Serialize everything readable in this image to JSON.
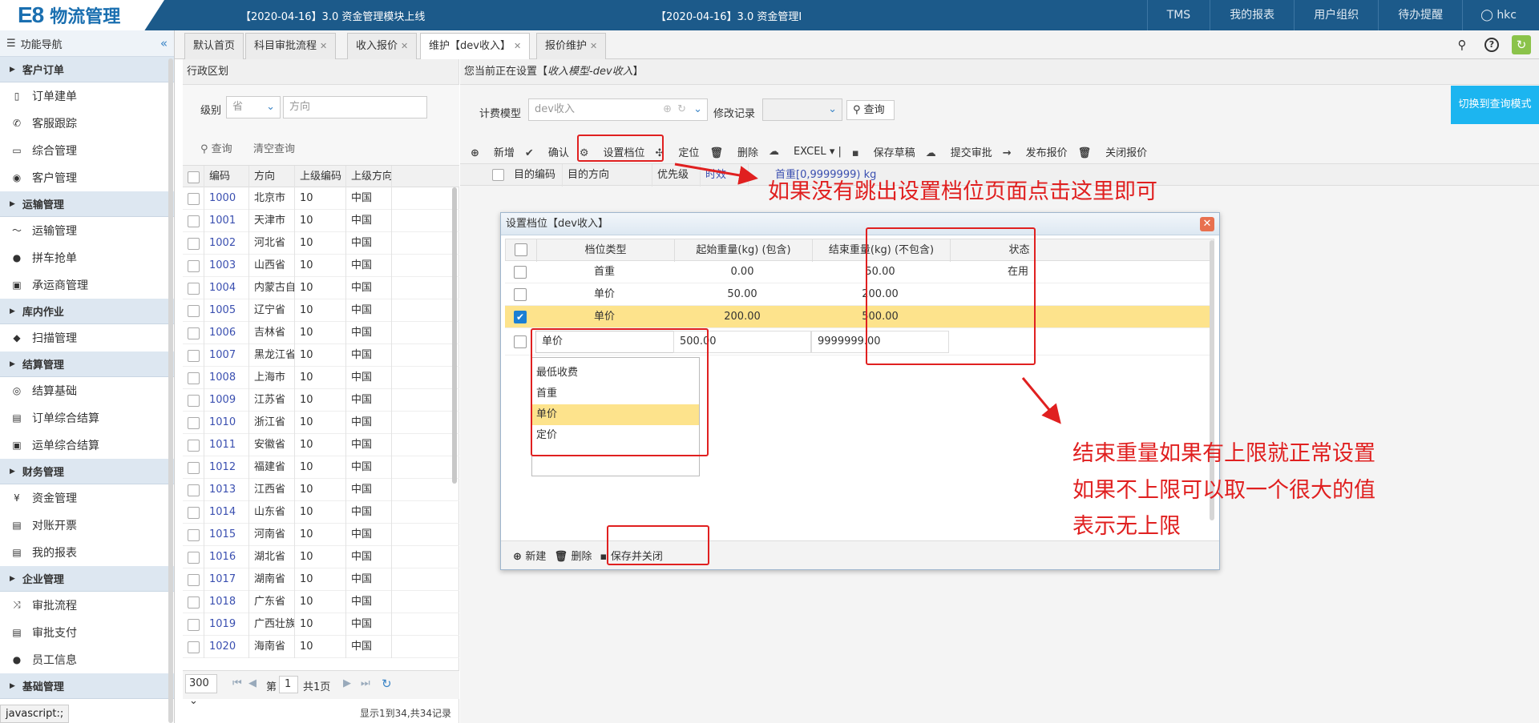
{
  "topbar": {
    "logo_mark": "E8",
    "logo_text": "物流管理",
    "notices": [
      "【2020-04-16】3.0 资金管理模块上线",
      "【2020-04-16】3.0 资金管理I"
    ],
    "nav": [
      "TMS",
      "我的报表",
      "用户组织",
      "待办提醒",
      "hkc"
    ]
  },
  "sidebar": {
    "title": "功能导航",
    "groups": [
      {
        "label": "客户订单",
        "items": [
          "订单建单",
          "客服跟踪",
          "综合管理",
          "客户管理"
        ]
      },
      {
        "label": "运输管理",
        "items": [
          "运输管理",
          "拼车抢单",
          "承运商管理"
        ]
      },
      {
        "label": "库内作业",
        "items": [
          "扫描管理"
        ]
      },
      {
        "label": "结算管理",
        "items": [
          "结算基础",
          "订单综合结算",
          "运单综合结算"
        ]
      },
      {
        "label": "财务管理",
        "items": [
          "资金管理",
          "对账开票",
          "我的报表"
        ]
      },
      {
        "label": "企业管理",
        "items": [
          "审批流程",
          "审批支付",
          "员工信息"
        ]
      },
      {
        "label": "基础管理",
        "items": []
      }
    ],
    "status": "javascript:;"
  },
  "tabs": [
    {
      "label": "默认首页",
      "closable": false
    },
    {
      "label": "科目审批流程",
      "closable": true
    },
    {
      "label": "收入报价",
      "closable": true
    },
    {
      "label": "维护【dev收入】",
      "closable": true,
      "active": true
    },
    {
      "label": "报价维护",
      "closable": true
    }
  ],
  "left_panel": {
    "title": "行政区划",
    "level_label": "级别",
    "level_value": "省",
    "direction_placeholder": "方向",
    "search_label": "查询",
    "clear_label": "清空查询",
    "columns": [
      "编码",
      "方向",
      "上级编码",
      "上级方向"
    ],
    "rows": [
      [
        "1000",
        "北京市",
        "10",
        "中国"
      ],
      [
        "1001",
        "天津市",
        "10",
        "中国"
      ],
      [
        "1002",
        "河北省",
        "10",
        "中国"
      ],
      [
        "1003",
        "山西省",
        "10",
        "中国"
      ],
      [
        "1004",
        "内蒙古自治区",
        "10",
        "中国"
      ],
      [
        "1005",
        "辽宁省",
        "10",
        "中国"
      ],
      [
        "1006",
        "吉林省",
        "10",
        "中国"
      ],
      [
        "1007",
        "黑龙江省",
        "10",
        "中国"
      ],
      [
        "1008",
        "上海市",
        "10",
        "中国"
      ],
      [
        "1009",
        "江苏省",
        "10",
        "中国"
      ],
      [
        "1010",
        "浙江省",
        "10",
        "中国"
      ],
      [
        "1011",
        "安徽省",
        "10",
        "中国"
      ],
      [
        "1012",
        "福建省",
        "10",
        "中国"
      ],
      [
        "1013",
        "江西省",
        "10",
        "中国"
      ],
      [
        "1014",
        "山东省",
        "10",
        "中国"
      ],
      [
        "1015",
        "河南省",
        "10",
        "中国"
      ],
      [
        "1016",
        "湖北省",
        "10",
        "中国"
      ],
      [
        "1017",
        "湖南省",
        "10",
        "中国"
      ],
      [
        "1018",
        "广东省",
        "10",
        "中国"
      ],
      [
        "1019",
        "广西壮族自治区",
        "10",
        "中国"
      ],
      [
        "1020",
        "海南省",
        "10",
        "中国"
      ]
    ],
    "pager": {
      "page_size": "300",
      "page_prefix": "第",
      "page": "1",
      "page_total": "共1页",
      "summary": "显示1到34,共34记录"
    }
  },
  "right_panel": {
    "title_prefix": "您当前正在设置【",
    "title_model": "收入模型-dev收入",
    "title_suffix": "】",
    "model_label": "计费模型",
    "model_value": "dev收入",
    "history_label": "修改记录",
    "search_label": "查询",
    "switch_label": "切换到查询模式",
    "actions": [
      "新增",
      "确认",
      "设置档位",
      "定位",
      "删除",
      "EXCEL",
      "保存草稿",
      "提交审批",
      "发布报价",
      "关闭报价"
    ],
    "columns": [
      "目的编码",
      "目的方向",
      "优先级",
      "时效",
      "首重[0,9999999) kg"
    ]
  },
  "dialog": {
    "title": "设置档位【dev收入】",
    "columns": [
      "档位类型",
      "起始重量(kg) (包含)",
      "结束重量(kg) (不包含)",
      "状态"
    ],
    "rows": [
      {
        "type": "首重",
        "start": "0.00",
        "end": "50.00",
        "status": "在用",
        "checked": false
      },
      {
        "type": "单价",
        "start": "50.00",
        "end": "200.00",
        "status": "",
        "checked": false
      },
      {
        "type": "单价",
        "start": "200.00",
        "end": "500.00",
        "status": "",
        "checked": true
      }
    ],
    "edit_row": {
      "type": "单价",
      "start": "500.00",
      "end": "9999999.00"
    },
    "dropdown_options": [
      "最低收费",
      "首重",
      "单价",
      "定价"
    ],
    "dropdown_selected": "单价",
    "footer": [
      "新建",
      "删除",
      "保存并关闭"
    ]
  },
  "annotations": {
    "top": "如果没有跳出设置档位页面点击这里即可",
    "right_lines": [
      "结束重量如果有上限就正常设置",
      "如果不上限可以取一个很大的值",
      "表示无上限"
    ],
    "color": "#e02020"
  },
  "colors": {
    "topbar": "#1c5a8a",
    "accent": "#1cb5f0",
    "selected_row": "#fde38c"
  }
}
